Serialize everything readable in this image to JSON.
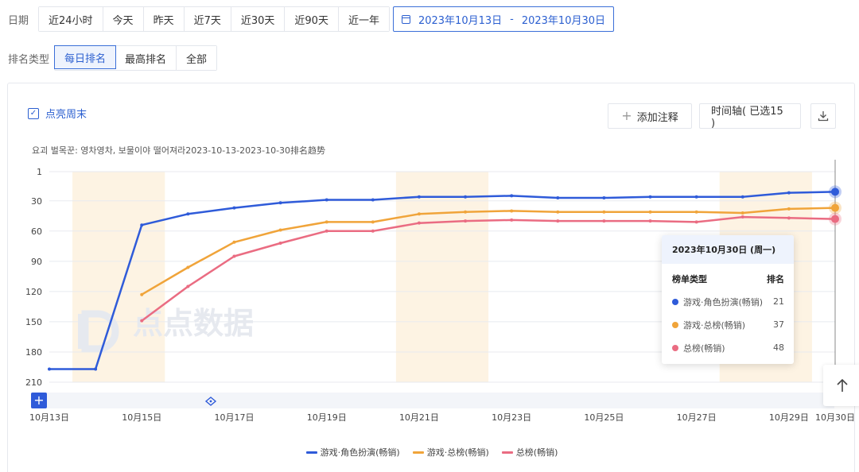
{
  "filters": {
    "date_label": "日期",
    "date_options": [
      "近24小时",
      "今天",
      "昨天",
      "近7天",
      "近30天",
      "近90天",
      "近一年"
    ],
    "date_range_start": "2023年10月13日",
    "date_range_sep": "-",
    "date_range_end": "2023年10月30日",
    "rank_type_label": "排名类型",
    "rank_type_options": [
      "每日排名",
      "最高排名",
      "全部"
    ],
    "rank_type_selected": 0
  },
  "toolbar": {
    "highlight_weekend_label": "点亮周末",
    "add_note_label": "添加注释",
    "timeline_label": "时间轴( 已选15 )"
  },
  "watermark": "点点数据",
  "tooltip": {
    "date": "2023年10月30日 (周一)",
    "col_type": "榜单类型",
    "col_rank": "排名",
    "rows": [
      {
        "name": "游戏·角色扮演(畅销)",
        "value": "21"
      },
      {
        "name": "游戏·总榜(畅销)",
        "value": "37"
      },
      {
        "name": "总榜(畅销)",
        "value": "48"
      }
    ]
  },
  "colors": {
    "accent": "#2b5fd0",
    "series_blue": "#2f5bd9",
    "series_orange": "#f0a43a",
    "series_pink": "#ea6c82",
    "weekend_band": "#fdf3e3",
    "grid": "#e8eaef"
  },
  "chart_data": {
    "type": "line",
    "title": "요괴 벌목꾼: 영차영차, 보물이야 떨어져라2023-10-13-2023-10-30排名趋势",
    "y_inverted": true,
    "yticks": [
      1,
      30,
      60,
      90,
      120,
      150,
      180,
      210
    ],
    "ylim": [
      1,
      210
    ],
    "x": [
      "10月13日",
      "10月14日",
      "10月15日",
      "10月16日",
      "10月17日",
      "10月18日",
      "10月19日",
      "10月20日",
      "10月21日",
      "10月22日",
      "10月23日",
      "10月24日",
      "10月25日",
      "10月26日",
      "10月27日",
      "10月28日",
      "10月29日",
      "10月30日"
    ],
    "x_tick_labels": [
      "10月13日",
      "10月15日",
      "10月17日",
      "10月19日",
      "10月21日",
      "10月23日",
      "10月25日",
      "10月27日",
      "10月29日",
      "10月30日"
    ],
    "weekend_bands": [
      [
        "10月14日",
        "10月15日"
      ],
      [
        "10月21日",
        "10月22日"
      ],
      [
        "10月28日",
        "10月29日"
      ]
    ],
    "series": [
      {
        "name": "游戏·角色扮演(畅销)",
        "color": "#2f5bd9",
        "values": [
          197,
          197,
          54,
          43,
          37,
          32,
          29,
          29,
          26,
          26,
          25,
          27,
          27,
          26,
          26,
          26,
          22,
          21
        ]
      },
      {
        "name": "游戏·总榜(畅销)",
        "color": "#f0a43a",
        "values": [
          null,
          null,
          123,
          96,
          71,
          59,
          51,
          51,
          43,
          41,
          40,
          41,
          41,
          41,
          41,
          42,
          38,
          37
        ]
      },
      {
        "name": "总榜(畅销)",
        "color": "#ea6c82",
        "values": [
          null,
          null,
          149,
          115,
          85,
          72,
          60,
          60,
          52,
          50,
          49,
          50,
          50,
          50,
          51,
          46,
          47,
          48
        ]
      }
    ],
    "legend": [
      "游戏·角色扮演(畅销)",
      "游戏·总榜(畅销)",
      "总榜(畅销)"
    ],
    "grid": true,
    "legend_position": "bottom"
  }
}
